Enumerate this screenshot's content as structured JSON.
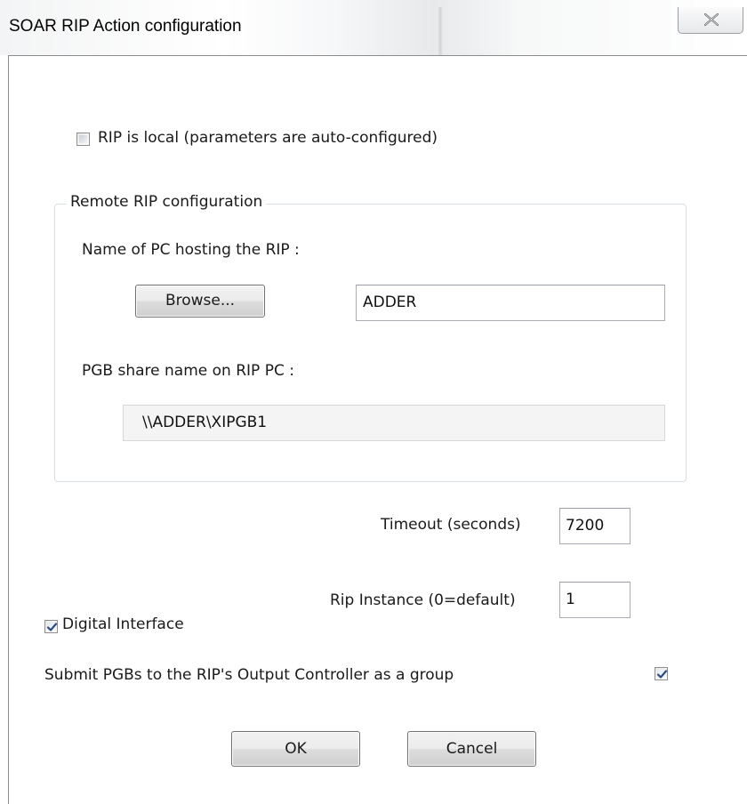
{
  "window": {
    "title": "SOAR RIP Action configuration",
    "close_icon": "close-x-icon"
  },
  "rip_local": {
    "label": "RIP is local (parameters are auto-configured)",
    "checked": false
  },
  "remote": {
    "group_label": "Remote RIP configuration",
    "pc_name_label": "Name of PC hosting the RIP :",
    "browse_label": "Browse...",
    "pc_name_value": "ADDER",
    "share_label": "PGB share name on RIP PC :",
    "share_value": "\\\\ADDER\\XIPGB1"
  },
  "timeout": {
    "label": "Timeout (seconds)",
    "value": "7200"
  },
  "rip_instance": {
    "label": "Rip Instance (0=default)",
    "value": "1"
  },
  "digital_interface": {
    "label": "Digital Interface",
    "checked": true
  },
  "submit_group": {
    "label": "Submit PGBs to the RIP's Output Controller as a group",
    "checked": true
  },
  "buttons": {
    "ok": "OK",
    "cancel": "Cancel"
  }
}
